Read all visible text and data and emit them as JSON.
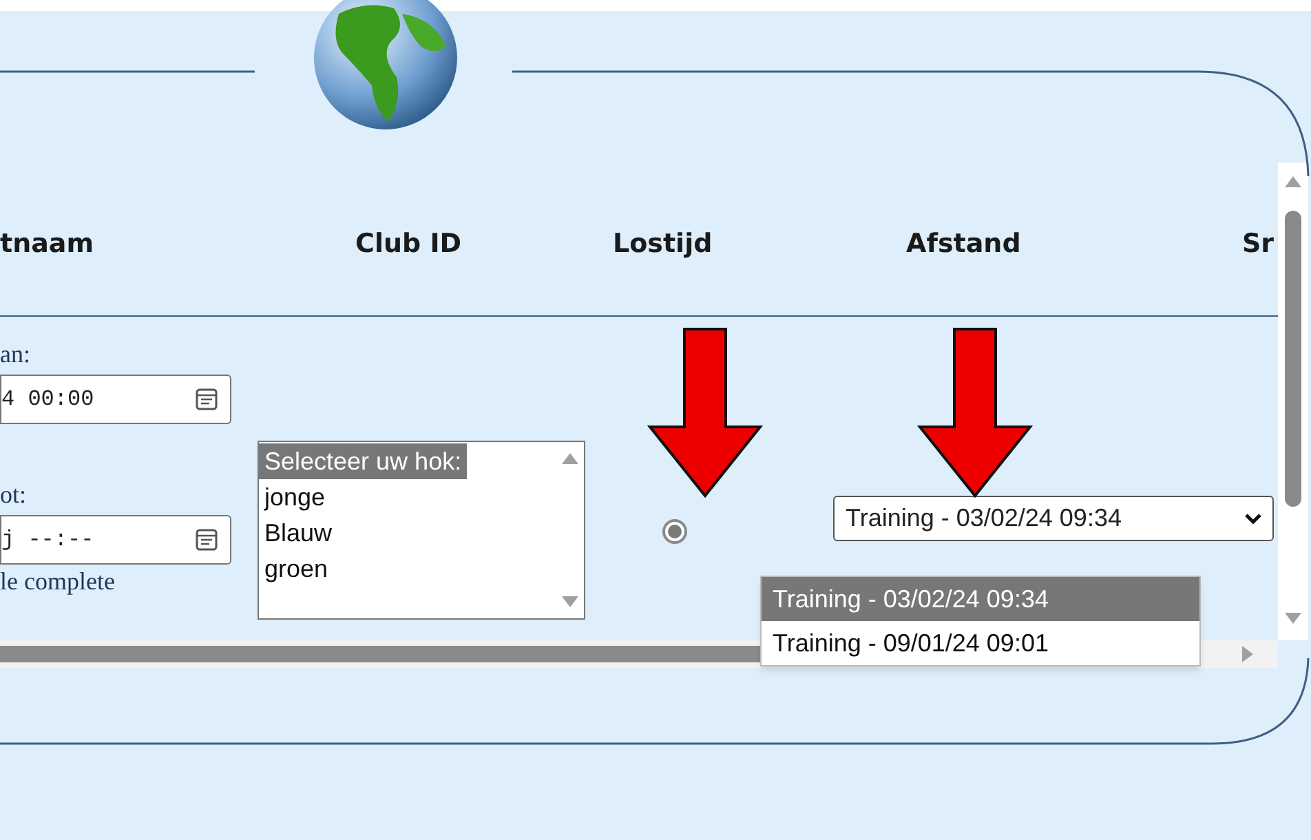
{
  "header_columns": [
    {
      "label": "tnaam"
    },
    {
      "label": "Club ID"
    },
    {
      "label": "Lostijd"
    },
    {
      "label": "Afstand"
    },
    {
      "label": "Sr"
    }
  ],
  "filter": {
    "from_label": "an:",
    "from_value": "4 00:00",
    "to_label": "ot:",
    "to_value": "j --:--",
    "note": "le complete"
  },
  "loft_list": {
    "options": [
      {
        "label": "Selecteer uw hok:",
        "selected": true
      },
      {
        "label": "jonge",
        "selected": false
      },
      {
        "label": "Blauw",
        "selected": false
      },
      {
        "label": "groen",
        "selected": false
      }
    ]
  },
  "radio": {
    "checked": true
  },
  "race_select": {
    "value": "Training - 03/02/24 09:34",
    "expanded": true,
    "options": [
      {
        "label": "Training - 03/02/24 09:34",
        "selected": true
      },
      {
        "label": "Training - 09/01/24 09:01",
        "selected": false
      }
    ]
  }
}
